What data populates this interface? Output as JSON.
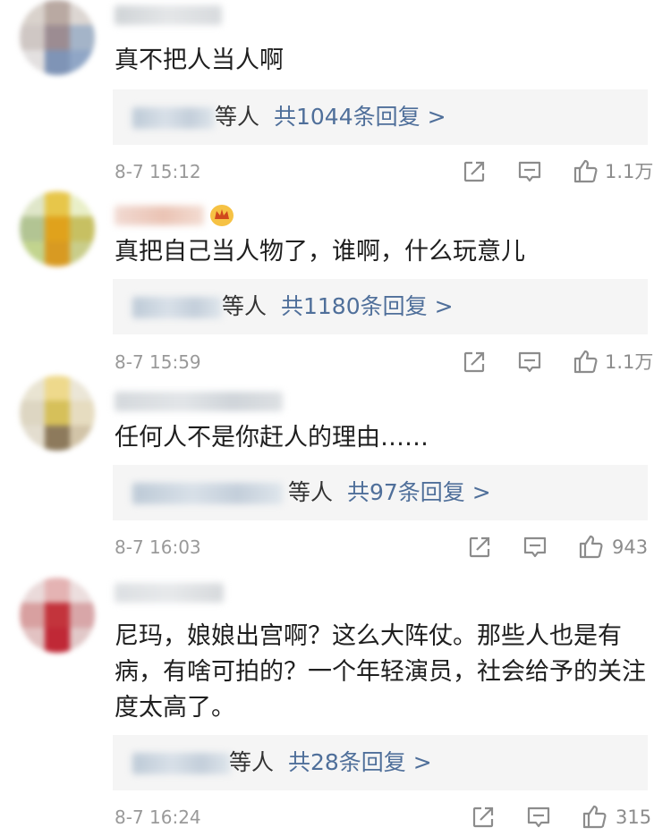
{
  "comments": [
    {
      "text": "真不把人当人啊",
      "reply_etc": "等人",
      "reply_count": "共1044条回复 >",
      "time": "8-7 15:12",
      "likes": "1.1万"
    },
    {
      "text": "真把自己当人物了，谁啊，什么玩意儿",
      "reply_etc": "等人",
      "reply_count": "共1180条回复 >",
      "time": "8-7 15:59",
      "likes": "1.1万"
    },
    {
      "text": "任何人不是你赶人的理由……",
      "reply_etc": "等人",
      "reply_count": "共97条回复 >",
      "time": "8-7 16:03",
      "likes": "943"
    },
    {
      "text": "尼玛，娘娘出宫啊？这么大阵仗。那些人也是有病，有啥可拍的？一个年轻演员，社会给予的关注度太高了。",
      "reply_etc": "等人",
      "reply_count": "共28条回复 >",
      "time": "8-7 16:24",
      "likes": "315"
    }
  ],
  "icons": {
    "share": "share-icon",
    "comment": "comment-icon",
    "like": "thumbs-up-icon",
    "vip": "crown-icon"
  },
  "colors": {
    "link": "#4f6f9a",
    "meta": "#999999",
    "reply_bg": "#f5f5f5"
  }
}
